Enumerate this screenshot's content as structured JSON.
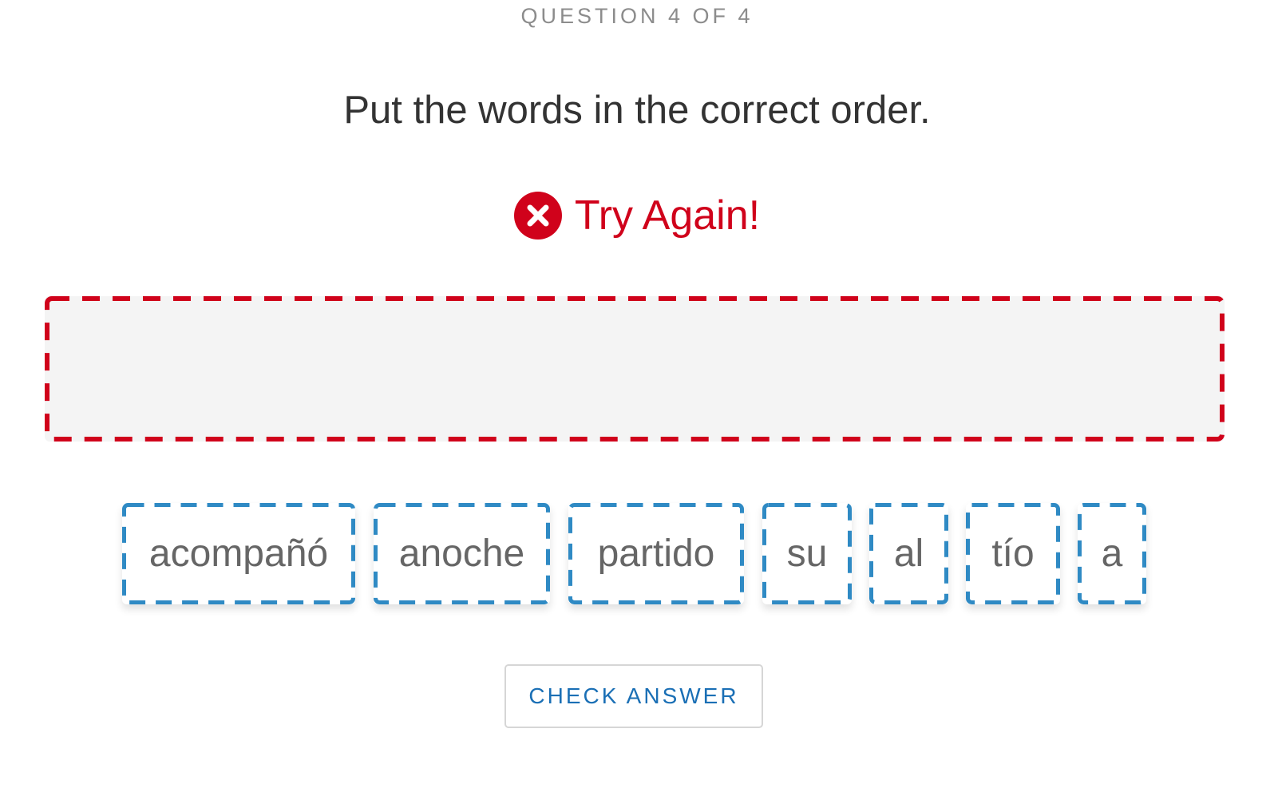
{
  "header": {
    "progress_label": "QUESTION 4 OF 4"
  },
  "question": {
    "prompt": "Put the words in the correct order."
  },
  "feedback": {
    "text": "Try Again!",
    "icon": "error-x-circle-icon",
    "color": "#d0021b"
  },
  "answer_area": {
    "state": "incorrect",
    "border_color": "#d0021b",
    "words": []
  },
  "word_bank": {
    "border_color": "#2f8ac4",
    "words": [
      "acompañó",
      "anoche",
      "partido",
      "su",
      "al",
      "tío",
      "a"
    ]
  },
  "actions": {
    "check_label": "CHECK ANSWER"
  }
}
